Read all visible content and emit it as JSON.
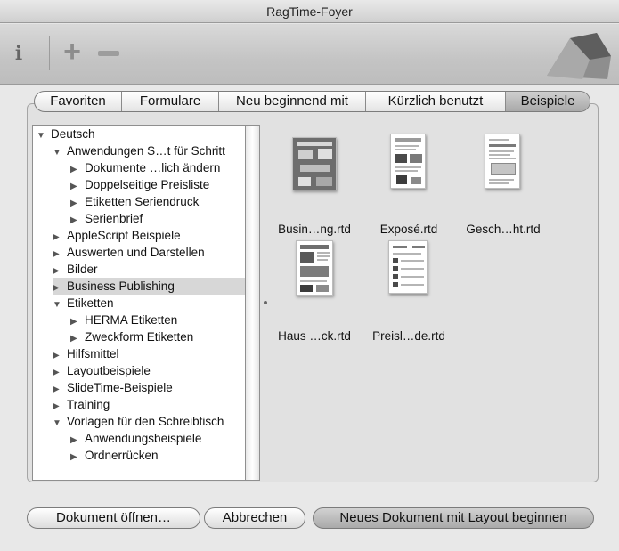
{
  "window": {
    "title": "RagTime-Foyer"
  },
  "toolbar": {
    "info_icon": "info-icon",
    "add_icon": "plus-icon",
    "remove_icon": "minus-icon",
    "logo": "ragtime-logo"
  },
  "tabs": [
    {
      "label": "Favoriten"
    },
    {
      "label": "Formulare"
    },
    {
      "label": "Neu beginnend mit"
    },
    {
      "label": "Kürzlich benutzt"
    },
    {
      "label": "Beispiele",
      "active": true
    }
  ],
  "tree": [
    {
      "label": "Deutsch",
      "level": 0,
      "expanded": true
    },
    {
      "label": "Anwendungen S…t für Schritt",
      "level": 1,
      "expanded": true
    },
    {
      "label": "Dokumente …lich ändern",
      "level": 2,
      "expanded": false
    },
    {
      "label": "Doppelseitige Preisliste",
      "level": 2,
      "expanded": false
    },
    {
      "label": "Etiketten Seriendruck",
      "level": 2,
      "expanded": false
    },
    {
      "label": "Serienbrief",
      "level": 2,
      "expanded": false
    },
    {
      "label": "AppleScript Beispiele",
      "level": 1,
      "expanded": false
    },
    {
      "label": "Auswerten und Darstellen",
      "level": 1,
      "expanded": false
    },
    {
      "label": "Bilder",
      "level": 1,
      "expanded": false
    },
    {
      "label": "Business Publishing",
      "level": 1,
      "expanded": false,
      "selected": true
    },
    {
      "label": "Etiketten",
      "level": 1,
      "expanded": true
    },
    {
      "label": "HERMA Etiketten",
      "level": 2,
      "expanded": false
    },
    {
      "label": "Zweckform Etiketten",
      "level": 2,
      "expanded": false
    },
    {
      "label": "Hilfsmittel",
      "level": 1,
      "expanded": false
    },
    {
      "label": "Layoutbeispiele",
      "level": 1,
      "expanded": false
    },
    {
      "label": "SlideTime-Beispiele",
      "level": 1,
      "expanded": false
    },
    {
      "label": "Training",
      "level": 1,
      "expanded": false
    },
    {
      "label": "Vorlagen für den Schreibtisch",
      "level": 1,
      "expanded": true
    },
    {
      "label": "Anwendungsbeispiele",
      "level": 2,
      "expanded": false
    },
    {
      "label": "Ordnerrücken",
      "level": 2,
      "expanded": false
    }
  ],
  "files": [
    {
      "name": "Busin…ng.rtd",
      "style": "dark-landscape"
    },
    {
      "name": "Exposé.rtd",
      "style": "portrait"
    },
    {
      "name": "Gesch…ht.rtd",
      "style": "portrait"
    },
    {
      "name": "Haus …ck.rtd",
      "style": "portrait"
    },
    {
      "name": "Preisl…de.rtd",
      "style": "portrait"
    }
  ],
  "buttons": {
    "open": "Dokument öffnen…",
    "cancel": "Abbrechen",
    "new_with_layout": "Neues Dokument mit Layout beginnen"
  }
}
